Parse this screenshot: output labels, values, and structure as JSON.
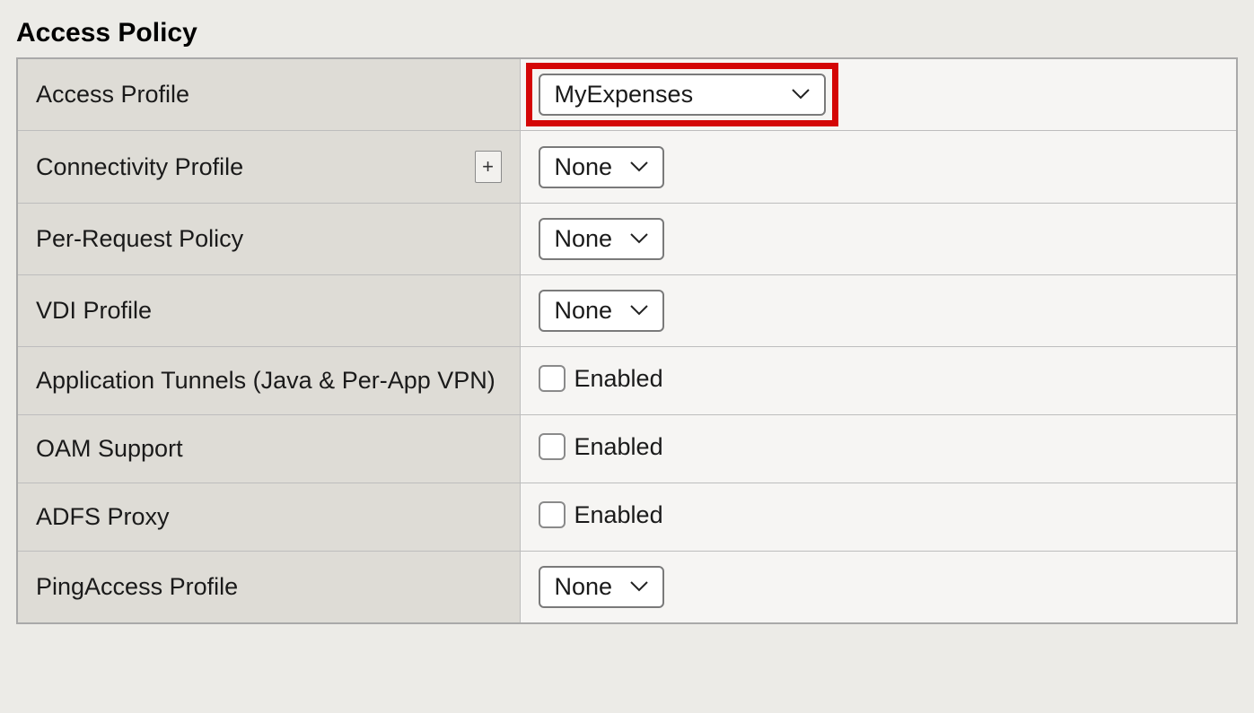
{
  "section_title": "Access Policy",
  "rows": {
    "access_profile": {
      "label": "Access Profile",
      "value": "MyExpenses"
    },
    "connectivity_profile": {
      "label": "Connectivity Profile",
      "value": "None",
      "plus_label": "+"
    },
    "per_request_policy": {
      "label": "Per-Request Policy",
      "value": "None"
    },
    "vdi_profile": {
      "label": "VDI Profile",
      "value": "None"
    },
    "app_tunnels": {
      "label": "Application Tunnels (Java & Per-App VPN)",
      "checkbox_label": "Enabled",
      "checked": false
    },
    "oam_support": {
      "label": "OAM Support",
      "checkbox_label": "Enabled",
      "checked": false
    },
    "adfs_proxy": {
      "label": "ADFS Proxy",
      "checkbox_label": "Enabled",
      "checked": false
    },
    "pingaccess_profile": {
      "label": "PingAccess Profile",
      "value": "None"
    }
  }
}
